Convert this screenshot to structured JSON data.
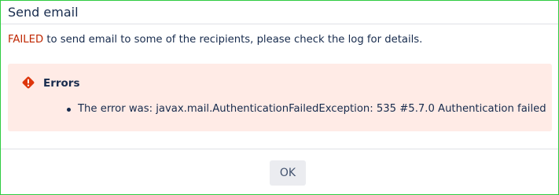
{
  "dialog": {
    "title": "Send email"
  },
  "message": {
    "status": "FAILED",
    "text": " to send email to some of the recipients, please check the log for details."
  },
  "errors": {
    "icon": "error-diamond-icon",
    "heading": "Errors",
    "items": [
      "The error was: javax.mail.AuthenticationFailedException: 535 #5.7.0 Authentication failed"
    ]
  },
  "footer": {
    "ok_label": "OK"
  },
  "colors": {
    "frame_border": "#2ecc40",
    "failed_text": "#bf2600",
    "error_background": "#ffebe6",
    "error_icon": "#de350b",
    "button_background": "#ebecf0"
  }
}
